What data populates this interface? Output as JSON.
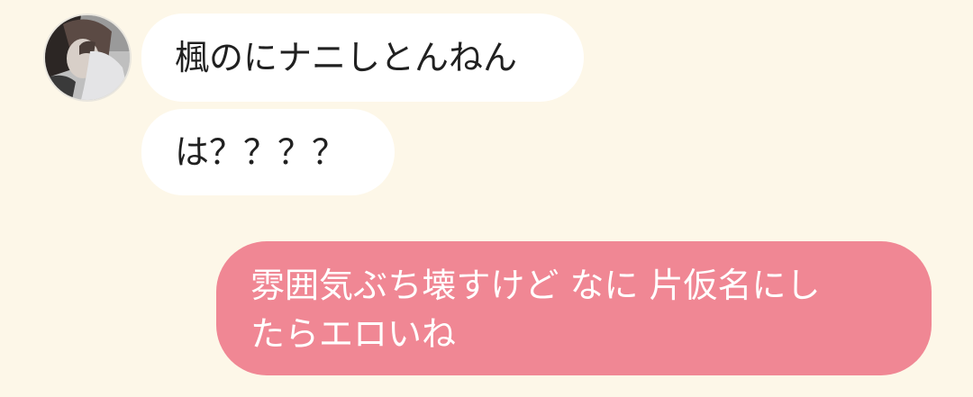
{
  "messages": [
    {
      "side": "in",
      "text": "楓のにナニしとんねん"
    },
    {
      "side": "in",
      "text": "は？？？？"
    },
    {
      "side": "out",
      "line1": "雰囲気ぶち壊すけど なに 片仮名にし",
      "line2": "たらエロいね"
    }
  ],
  "colors": {
    "background": "#fdf7e8",
    "incoming_bubble": "#ffffff",
    "outgoing_bubble": "#f08794"
  },
  "avatar": {
    "icon": "user-avatar-photo"
  }
}
